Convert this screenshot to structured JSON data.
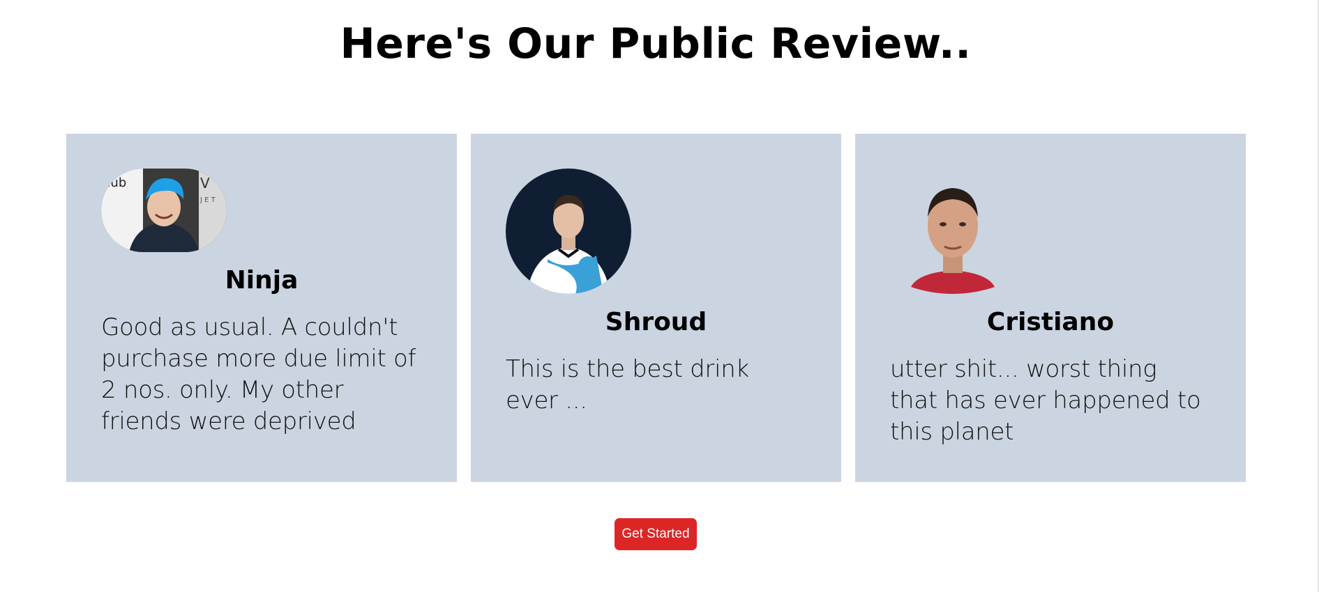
{
  "section": {
    "title": "Here's Our Public Review.."
  },
  "reviews": [
    {
      "name": "Ninja",
      "text": "Good as usual. A couldn't purchase more due limit of 2 nos. only. My other friends were deprived",
      "avatar_icon": "ninja-avatar"
    },
    {
      "name": "Shroud",
      "text": "This is the best drink ever ...",
      "avatar_icon": "shroud-avatar"
    },
    {
      "name": "Cristiano",
      "text": "utter shit... worst thing that has ever happened to this planet",
      "avatar_icon": "cristiano-avatar"
    }
  ],
  "cta": {
    "label": "Get Started",
    "color": "#dc2626"
  },
  "colors": {
    "card_background": "#cbd5e1"
  }
}
